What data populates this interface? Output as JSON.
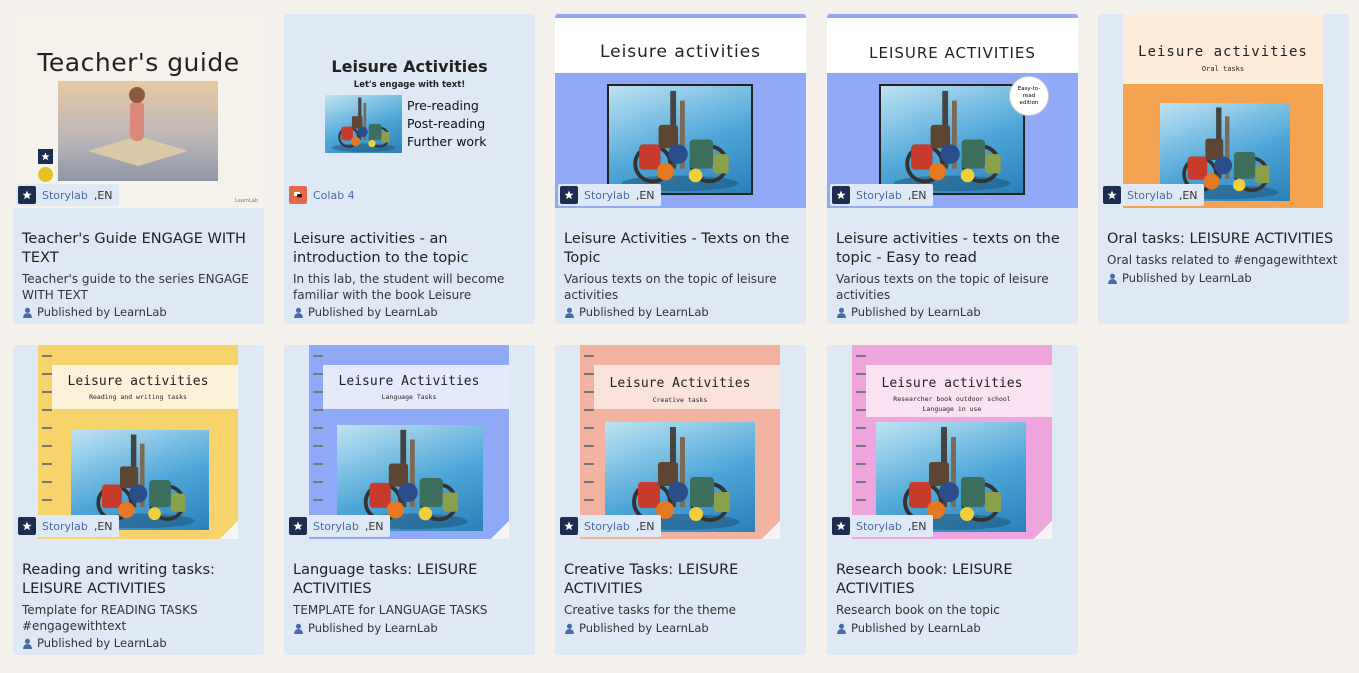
{
  "colors": {
    "card_bg": "#dfe8f5",
    "page_bg": "#f4f0ec",
    "source_link": "#4a6aa5",
    "storylab_icon": "#1d2d4f",
    "colab_icon": "#e2694a"
  },
  "cards": [
    {
      "cover": {
        "heading": "Teacher's guide",
        "brand": "LearnLab"
      },
      "badge": {
        "source": "Storylab",
        "lang": ",EN",
        "icon": "storylab-icon"
      },
      "title": "Teacher's Guide ENGAGE WITH TEXT",
      "description": "Teacher's guide to the series ENGAGE WITH TEXT",
      "published": "Published by LearnLab"
    },
    {
      "cover": {
        "heading": "Leisure Activities",
        "subheading": "Let's engage with text!",
        "items": [
          "Pre-reading",
          "Post-reading",
          "Further work"
        ]
      },
      "badge": {
        "source": "Colab 4",
        "lang": "",
        "icon": "colab-icon"
      },
      "title": "Leisure activities - an introduction to the topic",
      "description": "In this lab, the student will become familiar with the book Leisure Activities....",
      "published": "Published by LearnLab"
    },
    {
      "cover": {
        "heading": "Leisure activities"
      },
      "badge": {
        "source": "Storylab",
        "lang": ",EN",
        "icon": "storylab-icon"
      },
      "title": "Leisure Activities - Texts on the Topic",
      "description": "Various texts on the topic of leisure activities",
      "published": "Published by LearnLab"
    },
    {
      "cover": {
        "heading": "LEISURE ACTIVITIES",
        "sticker": "Easy-to-read edition"
      },
      "badge": {
        "source": "Storylab",
        "lang": ",EN",
        "icon": "storylab-icon"
      },
      "title": "Leisure activities - texts on the topic - Easy to read",
      "description": "Various texts on the topic of leisure activities",
      "published": "Published by LearnLab"
    },
    {
      "cover": {
        "heading": "Leisure activities",
        "subheading": "Oral tasks"
      },
      "badge": {
        "source": "Storylab",
        "lang": ",EN",
        "icon": "storylab-icon"
      },
      "title": "Oral tasks: LEISURE ACTIVITIES",
      "description": "Oral tasks related to #engagewithtext",
      "published": "Published by LearnLab"
    },
    {
      "cover": {
        "heading": "Leisure activities",
        "subheading": "Reading and writing tasks"
      },
      "badge": {
        "source": "Storylab",
        "lang": ",EN",
        "icon": "storylab-icon"
      },
      "title": "Reading and writing tasks: LEISURE ACTIVITIES",
      "description": "Template for READING TASKS #engagewithtext",
      "published": "Published by LearnLab"
    },
    {
      "cover": {
        "heading": "Leisure Activities",
        "subheading": "Language Tasks"
      },
      "badge": {
        "source": "Storylab",
        "lang": ",EN",
        "icon": "storylab-icon"
      },
      "title": "Language tasks: LEISURE ACTIVITIES",
      "description": "TEMPLATE for LANGUAGE TASKS",
      "published": "Published by LearnLab"
    },
    {
      "cover": {
        "heading": "Leisure Activities",
        "subheading": "Creative tasks"
      },
      "badge": {
        "source": "Storylab",
        "lang": ",EN",
        "icon": "storylab-icon"
      },
      "title": "Creative Tasks: LEISURE ACTIVITIES",
      "description": "Creative tasks for the theme",
      "published": "Published by LearnLab"
    },
    {
      "cover": {
        "heading": "Leisure activities",
        "subheading": "Researcher book outdoor school",
        "subheading2": "Language in use"
      },
      "badge": {
        "source": "Storylab",
        "lang": ",EN",
        "icon": "storylab-icon"
      },
      "title": "Research book: LEISURE ACTIVITIES",
      "description": "Research book on the topic",
      "published": "Published by LearnLab"
    }
  ]
}
